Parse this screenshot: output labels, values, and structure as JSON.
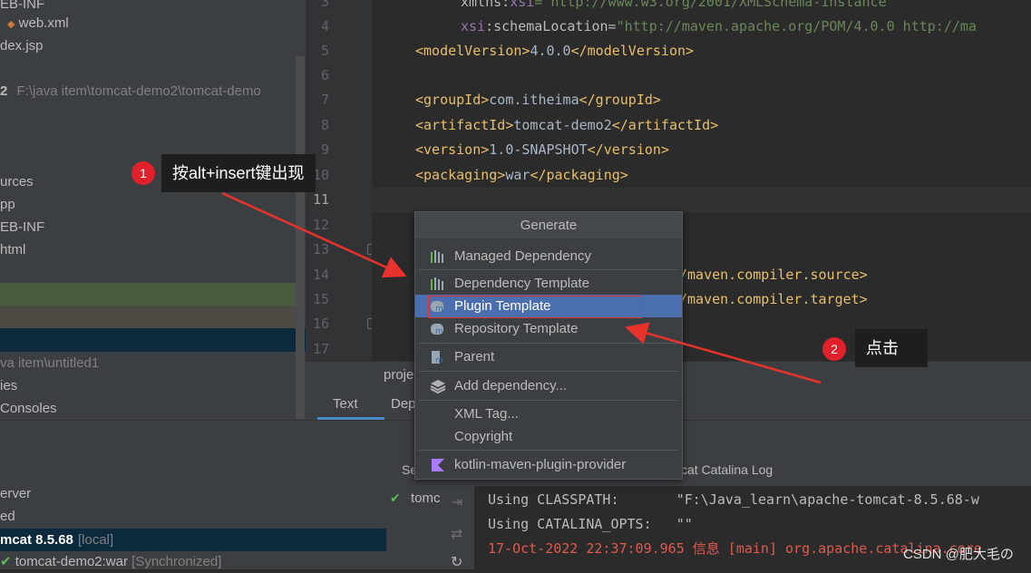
{
  "project_tree": {
    "rows": [
      "EB-INF",
      "web.xml",
      "dex.jsp",
      "2",
      "F:\\java item\\tomcat-demo2\\tomcat-demo",
      "urces",
      "pp",
      "EB-INF",
      "html",
      "va item\\untitled1",
      "ies",
      "Consoles"
    ]
  },
  "editor": {
    "line_numbers": [
      "3",
      "4",
      "5",
      "6",
      "7",
      "8",
      "9",
      "10",
      "11",
      "12",
      "13",
      "14",
      "15",
      "16",
      "17"
    ],
    "lines": {
      "l3_a": "xmlns:",
      "l3_b": "xsi",
      "l3_c": "=\"http://www.w3.org/2001/XMLSchema-instance\"",
      "l4_a": "xsi",
      "l4_b": ":schemaLocation=",
      "l4_c": "\"http://maven.apache.org/POM/4.0.0 http://ma",
      "l5_open": "<modelVersion>",
      "l5_val": "4.0.0",
      "l5_close": "</modelVersion>",
      "l7_open": "<groupId>",
      "l7_val": "com.itheima",
      "l7_close": "</groupId>",
      "l8_open": "<artifactId>",
      "l8_val": "tomcat-demo2",
      "l8_close": "</artifactId>",
      "l9_open": "<version>",
      "l9_val": "1.0-SNAPSHOT",
      "l9_close": "</version>",
      "l10_open": "<packaging>",
      "l10_val": "war",
      "l10_close": "</packaging>",
      "l14_tail": "/maven.compiler.source>",
      "l15_tail": "/maven.compiler.target>"
    },
    "breadcrumb": "proje",
    "tabs": [
      "Text",
      "Dep"
    ]
  },
  "generate_popup": {
    "title": "Generate",
    "items": [
      "Managed Dependency",
      "Dependency Template",
      "Plugin Template",
      "Repository Template",
      "Parent",
      "Add dependency...",
      "XML Tag...",
      "Copyright",
      "kotlin-maven-plugin-provider"
    ],
    "selected": "Plugin Template"
  },
  "annotations": {
    "step1_num": "1",
    "step1_text": "按alt+insert键出现",
    "step2_num": "2",
    "step2_text": "点击",
    "arrow_color": "#e8322c"
  },
  "services": {
    "rows": [
      "erver",
      "ed",
      "mcat 8.5.68",
      "[local]",
      "tomcat-demo2:war",
      "[Synchronized]"
    ],
    "tab_partial": "Se",
    "tab_log": "cat Catalina Log",
    "deploy_item": "tomc"
  },
  "console": {
    "lines": [
      {
        "text": "Using CLASSPATH:       \"F:\\Java_learn\\apache-tomcat-8.5.68-w",
        "color": "#bbbbbb"
      },
      {
        "text": "Using CATALINA_OPTS:   \"\"",
        "color": "#bbbbbb"
      },
      {
        "text": "17-Oct-2022 22:37:09.965 信息 [main] org.apache.catalina.core",
        "color": "#e05a4e"
      }
    ],
    "watermark": "CSDN @肥大毛の"
  },
  "colors": {
    "selection": "#4b6eaf",
    "popup_bg": "#3c3f41",
    "editor_bg": "#2b2b2b",
    "badge": "#e0202a"
  }
}
